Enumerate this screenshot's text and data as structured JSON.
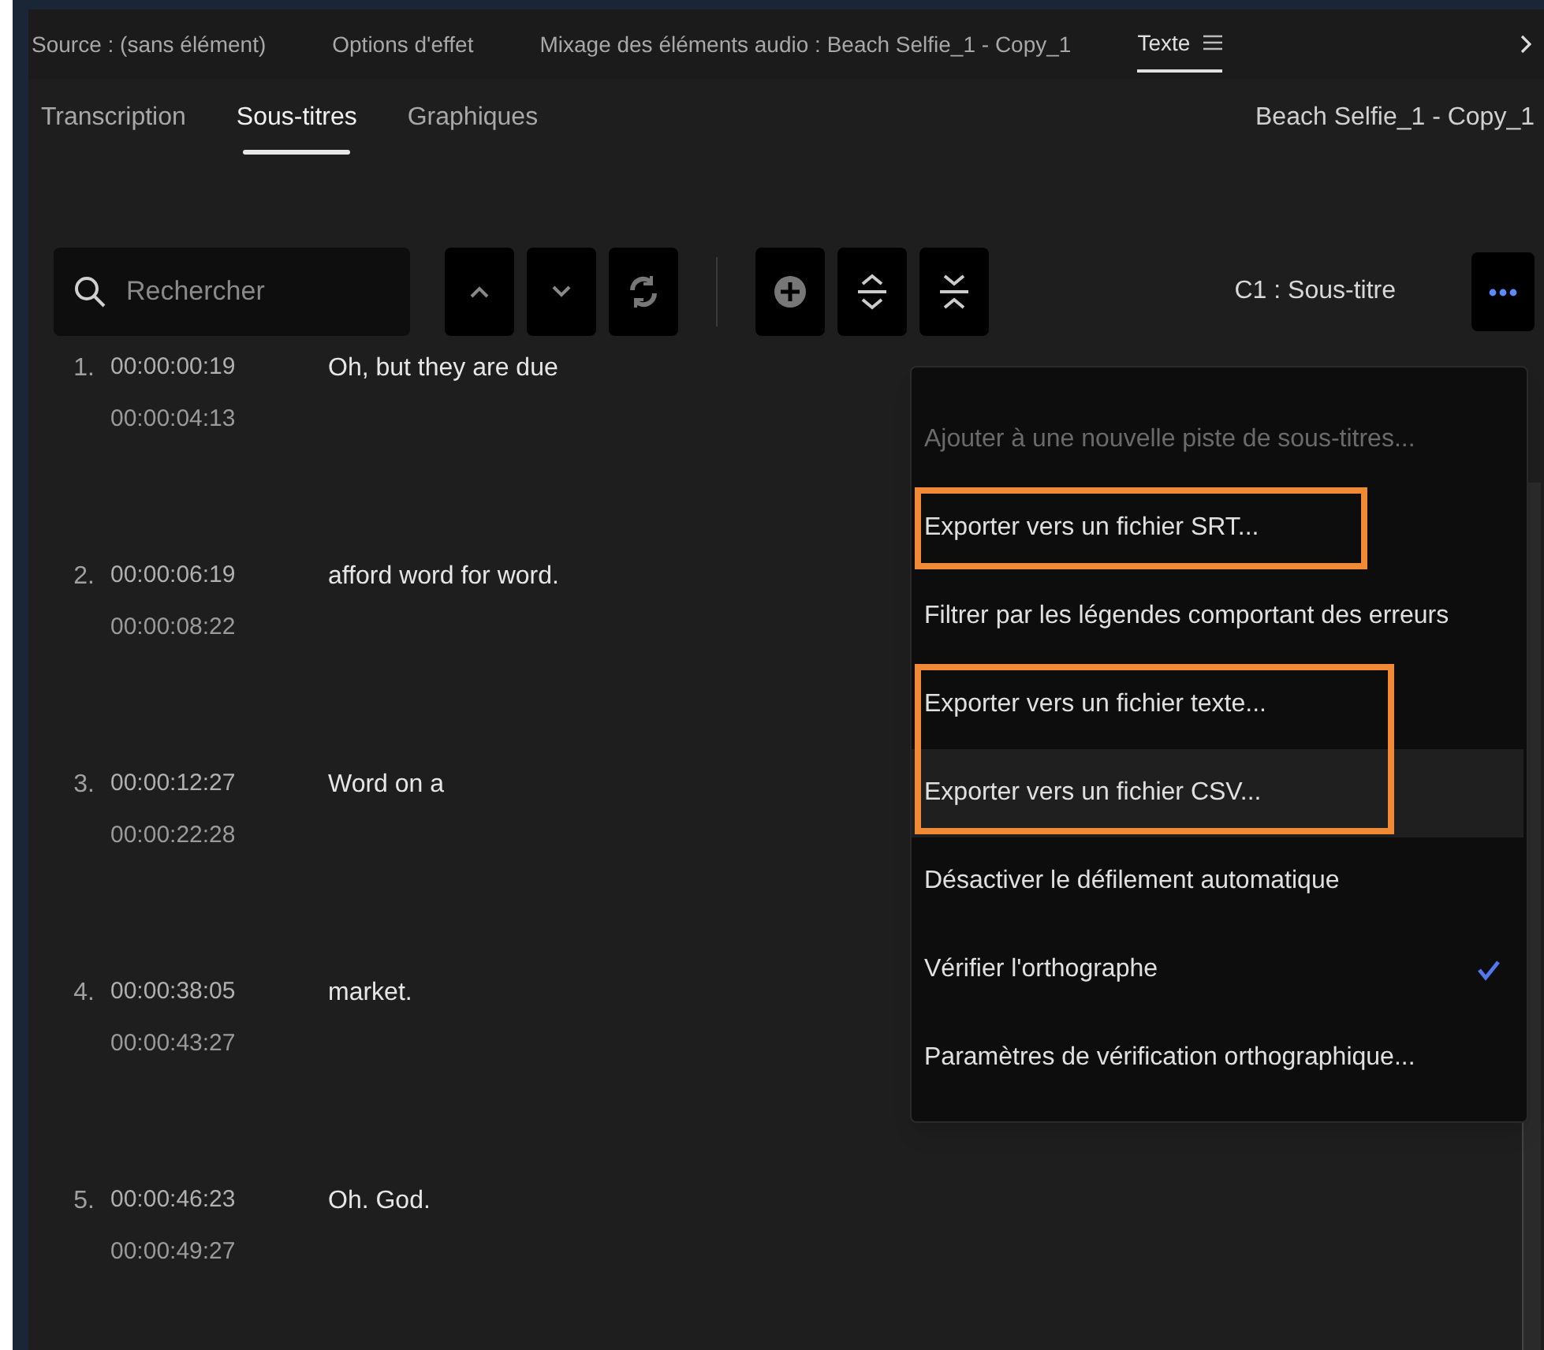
{
  "panel_tabs": [
    {
      "label": "Source : (sans élément)",
      "selected": false
    },
    {
      "label": "Options d'effet",
      "selected": false
    },
    {
      "label": "Mixage des éléments audio : Beach Selfie_1 - Copy_1",
      "selected": false
    },
    {
      "label": "Texte",
      "selected": true
    }
  ],
  "tabs": [
    {
      "label": "Transcription",
      "selected": false
    },
    {
      "label": "Sous-titres",
      "selected": true
    },
    {
      "label": "Graphiques",
      "selected": false
    }
  ],
  "clip_name": "Beach Selfie_1 - Copy_1",
  "search": {
    "placeholder": "Rechercher"
  },
  "track_label": "C1 : Sous-titre",
  "captions": [
    {
      "number": "1.",
      "start": "00:00:00:19",
      "end": "00:00:04:13",
      "text": "Oh, but they are due"
    },
    {
      "number": "2.",
      "start": "00:00:06:19",
      "end": "00:00:08:22",
      "text": "afford word for word."
    },
    {
      "number": "3.",
      "start": "00:00:12:27",
      "end": "00:00:22:28",
      "text": "Word on a"
    },
    {
      "number": "4.",
      "start": "00:00:38:05",
      "end": "00:00:43:27",
      "text": "market."
    },
    {
      "number": "5.",
      "start": "00:00:46:23",
      "end": "00:00:49:27",
      "text": "Oh. God."
    }
  ],
  "menu": [
    {
      "label": "Ajouter à une nouvelle piste de sous-titres...",
      "disabled": true,
      "outlined": false,
      "hovered": false,
      "checked": false
    },
    {
      "label": "Exporter vers un fichier SRT...",
      "disabled": false,
      "outlined": true,
      "hovered": false,
      "checked": false
    },
    {
      "label": "Filtrer par les légendes comportant des erreurs",
      "disabled": false,
      "outlined": false,
      "hovered": false,
      "checked": false
    },
    {
      "label": "Exporter vers un fichier texte...",
      "disabled": false,
      "outlined": true,
      "hovered": false,
      "checked": false
    },
    {
      "label": "Exporter vers un fichier CSV...",
      "disabled": false,
      "outlined": true,
      "hovered": true,
      "checked": false
    },
    {
      "label": "Désactiver le défilement automatique",
      "disabled": false,
      "outlined": false,
      "hovered": false,
      "checked": false
    },
    {
      "label": "Vérifier l'orthographe",
      "disabled": false,
      "outlined": false,
      "hovered": false,
      "checked": true
    },
    {
      "label": "Paramètres de vérification orthographique...",
      "disabled": false,
      "outlined": false,
      "hovered": false,
      "checked": false
    }
  ]
}
